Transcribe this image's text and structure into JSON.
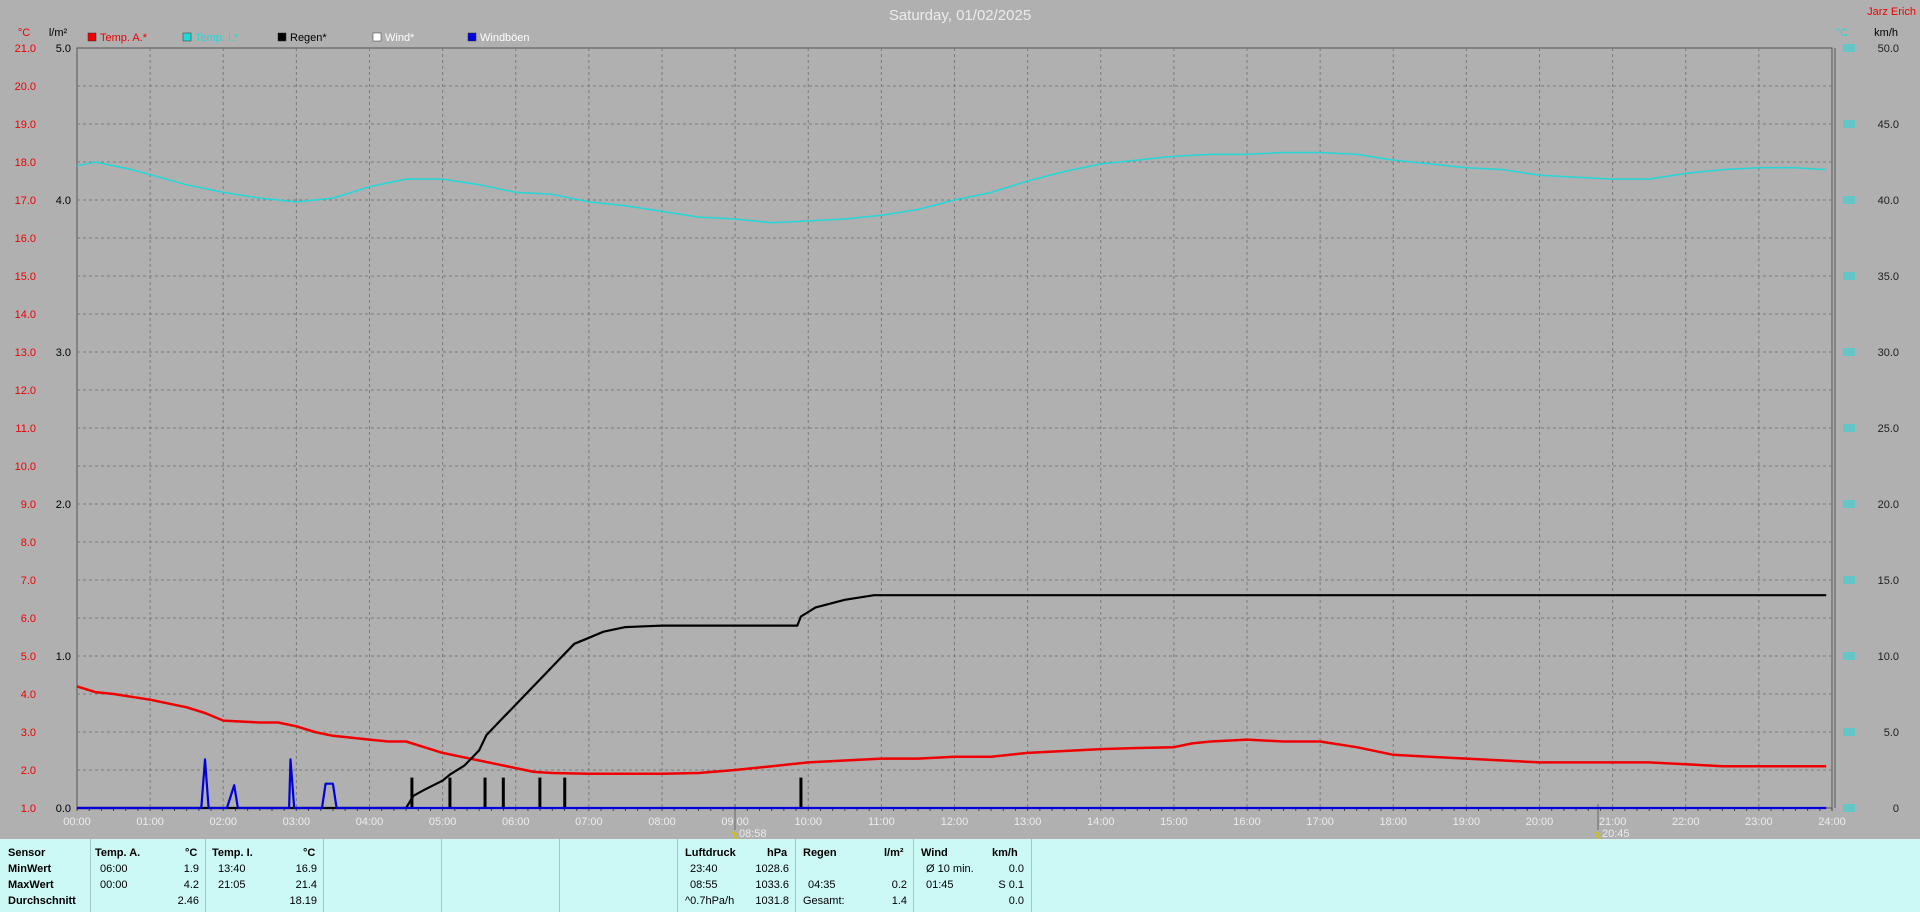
{
  "title": "Saturday, 01/02/2025",
  "user": "Jarz Erich",
  "colors": {
    "temp_a": "#ee0000",
    "temp_i": "#22d8d8",
    "regen": "#000000",
    "wind": "#ffffff",
    "windboeen": "#0000dd",
    "background": "#b0b0b0",
    "grid": "#7a7a7a",
    "panel": "#ccf8f6"
  },
  "legend": [
    {
      "label": "Temp. A.*",
      "color": "#ee0000",
      "text_color": "#ee0000"
    },
    {
      "label": "Temp. I.*",
      "color": "#22d8d8",
      "text_color": "#22d8d8"
    },
    {
      "label": "Regen*",
      "color": "#000000",
      "text_color": "#000000"
    },
    {
      "label": "Wind*",
      "color": "#ffffff",
      "text_color": "#ffffff"
    },
    {
      "label": "Windböen",
      "color": "#0000dd",
      "text_color": "#ffffff"
    }
  ],
  "axis_units": {
    "temp": "°C",
    "rain": "l/m²",
    "right_temp": "°C",
    "wind": "km/h"
  },
  "markers": [
    {
      "label": "08:58"
    },
    {
      "label": "20:45"
    }
  ],
  "chart_data": {
    "type": "line",
    "x_unit": "hour",
    "xlim": [
      0,
      24
    ],
    "x_ticks": [
      "00:00",
      "01:00",
      "02:00",
      "03:00",
      "04:00",
      "05:00",
      "06:00",
      "07:00",
      "08:00",
      "09:00",
      "10:00",
      "11:00",
      "12:00",
      "13:00",
      "14:00",
      "15:00",
      "16:00",
      "17:00",
      "18:00",
      "19:00",
      "20:00",
      "21:00",
      "22:00",
      "23:00",
      "24:00"
    ],
    "temp_axis": {
      "lim": [
        1,
        21
      ],
      "ticks": [
        "1.0",
        "2.0",
        "3.0",
        "4.0",
        "5.0",
        "6.0",
        "7.0",
        "8.0",
        "9.0",
        "10.0",
        "11.0",
        "12.0",
        "13.0",
        "14.0",
        "15.0",
        "16.0",
        "17.0",
        "18.0",
        "19.0",
        "20.0",
        "21.0"
      ]
    },
    "rain_axis": {
      "lim": [
        0,
        5
      ],
      "ticks": [
        "0.0",
        "1.0",
        "2.0",
        "3.0",
        "4.0",
        "5.0"
      ]
    },
    "wind_axis": {
      "lim": [
        0,
        50
      ],
      "ticks": [
        "0",
        "5.0",
        "10.0",
        "15.0",
        "20.0",
        "25.0",
        "30.0",
        "35.0",
        "40.0",
        "45.0",
        "50.0"
      ]
    },
    "series": [
      {
        "name": "Temp. A.*",
        "axis": "temp",
        "x": [
          0,
          0.25,
          0.5,
          1,
          1.5,
          1.75,
          2,
          2.5,
          2.75,
          3,
          3.25,
          3.5,
          4,
          4.25,
          4.5,
          4.75,
          5,
          5.25,
          5.5,
          5.75,
          6,
          6.25,
          6.5,
          7,
          7.5,
          8,
          8.5,
          9,
          9.5,
          10,
          10.5,
          11,
          11.5,
          12,
          12.5,
          13,
          13.5,
          14,
          14.5,
          15,
          15.25,
          15.5,
          16,
          16.5,
          17,
          17.5,
          18,
          18.5,
          19,
          19.5,
          20,
          20.5,
          21,
          21.5,
          22,
          22.5,
          23,
          23.5,
          23.92
        ],
        "y": [
          4.2,
          4.05,
          4.0,
          3.85,
          3.65,
          3.5,
          3.3,
          3.25,
          3.25,
          3.15,
          3.0,
          2.9,
          2.8,
          2.75,
          2.75,
          2.6,
          2.45,
          2.35,
          2.25,
          2.15,
          2.05,
          1.95,
          1.92,
          1.9,
          1.9,
          1.9,
          1.92,
          2.0,
          2.1,
          2.2,
          2.25,
          2.3,
          2.3,
          2.35,
          2.35,
          2.45,
          2.5,
          2.55,
          2.58,
          2.6,
          2.7,
          2.75,
          2.8,
          2.75,
          2.75,
          2.6,
          2.4,
          2.35,
          2.3,
          2.25,
          2.2,
          2.2,
          2.2,
          2.2,
          2.15,
          2.1,
          2.1,
          2.1,
          2.1
        ]
      },
      {
        "name": "Temp. I.*",
        "axis": "temp",
        "x": [
          0,
          0.25,
          0.75,
          1.5,
          2,
          2.5,
          3,
          3.5,
          4,
          4.5,
          5,
          5.5,
          6,
          6.5,
          7,
          7.5,
          8,
          8.5,
          9,
          9.5,
          10,
          10.5,
          11,
          11.5,
          12,
          12.5,
          13,
          13.5,
          14,
          14.5,
          15,
          15.5,
          16,
          16.5,
          17,
          17.5,
          18,
          18.5,
          19,
          19.5,
          20,
          20.5,
          21,
          21.5,
          22,
          22.5,
          23,
          23.5,
          23.92
        ],
        "y": [
          17.9,
          18.0,
          17.8,
          17.4,
          17.2,
          17.05,
          16.95,
          17.05,
          17.35,
          17.55,
          17.55,
          17.4,
          17.2,
          17.15,
          16.95,
          16.85,
          16.7,
          16.55,
          16.5,
          16.4,
          16.45,
          16.5,
          16.6,
          16.75,
          17.0,
          17.2,
          17.5,
          17.75,
          17.95,
          18.05,
          18.15,
          18.2,
          18.2,
          18.25,
          18.25,
          18.2,
          18.05,
          17.95,
          17.85,
          17.8,
          17.65,
          17.6,
          17.55,
          17.55,
          17.7,
          17.8,
          17.85,
          17.85,
          17.8
        ]
      },
      {
        "name": "Regen*",
        "axis": "rain",
        "x": [
          0,
          4.5,
          4.6,
          4.75,
          5,
          5.1,
          5.3,
          5.5,
          5.6,
          5.8,
          6.0,
          6.2,
          6.4,
          6.6,
          6.8,
          7.0,
          7.2,
          7.5,
          8,
          9,
          9.85,
          9.9,
          10.1,
          10.5,
          10.9,
          11,
          12,
          13,
          14,
          15,
          16,
          17,
          18,
          19,
          20,
          21,
          22,
          23,
          23.92
        ],
        "y": [
          0,
          0,
          0.08,
          0.12,
          0.18,
          0.22,
          0.28,
          0.38,
          0.48,
          0.58,
          0.68,
          0.78,
          0.88,
          0.98,
          1.08,
          1.12,
          1.16,
          1.19,
          1.2,
          1.2,
          1.2,
          1.26,
          1.32,
          1.37,
          1.4,
          1.4,
          1.4,
          1.4,
          1.4,
          1.4,
          1.4,
          1.4,
          1.4,
          1.4,
          1.4,
          1.4,
          1.4,
          1.4,
          1.4
        ]
      },
      {
        "name": "Windböen",
        "axis": "wind",
        "x": [
          0,
          1.7,
          1.75,
          1.8,
          2.05,
          2.15,
          2.2,
          2.9,
          2.92,
          2.97,
          3.02,
          3.35,
          3.4,
          3.5,
          3.55,
          23.92
        ],
        "y": [
          0,
          0,
          3.2,
          0,
          0,
          1.5,
          0,
          0,
          3.2,
          0,
          0,
          0,
          1.6,
          1.6,
          0,
          0
        ]
      }
    ],
    "rain_ticks_x": [
      4.58,
      5.1,
      5.58,
      5.83,
      6.33,
      6.67,
      9.9
    ],
    "rain_ticks_y": [
      0.2,
      0.2,
      0.2,
      0.2,
      0.2,
      0.2,
      0.2
    ],
    "grid": true
  },
  "stats": {
    "col_sensor": {
      "header": "Sensor",
      "rows": [
        "MinWert",
        "MaxWert",
        "Durchschnitt"
      ]
    },
    "temp_a": {
      "header": "Temp. A.",
      "unit": "°C",
      "times": [
        "06:00",
        "00:00",
        ""
      ],
      "values": [
        "1.9",
        "4.2",
        "2.46"
      ]
    },
    "temp_i": {
      "header": "Temp. I.",
      "unit": "°C",
      "times": [
        "13:40",
        "21:05",
        ""
      ],
      "values": [
        "16.9",
        "21.4",
        "18.19"
      ]
    },
    "luftdruck": {
      "header": "Luftdruck",
      "unit": "hPa",
      "times": [
        "23:40",
        "08:55",
        "^0.7hPa/h"
      ],
      "values": [
        "1028.6",
        "1033.6",
        "1031.8"
      ]
    },
    "regen": {
      "header": "Regen",
      "unit": "l/m²",
      "times": [
        "",
        "04:35",
        "Gesamt:"
      ],
      "values": [
        "",
        "0.2",
        "1.4"
      ]
    },
    "wind": {
      "header": "Wind",
      "unit": "km/h",
      "times": [
        "Ø 10 min.",
        "01:45",
        ""
      ],
      "values": [
        "0.0",
        "S 0.1",
        "0.0"
      ]
    }
  }
}
